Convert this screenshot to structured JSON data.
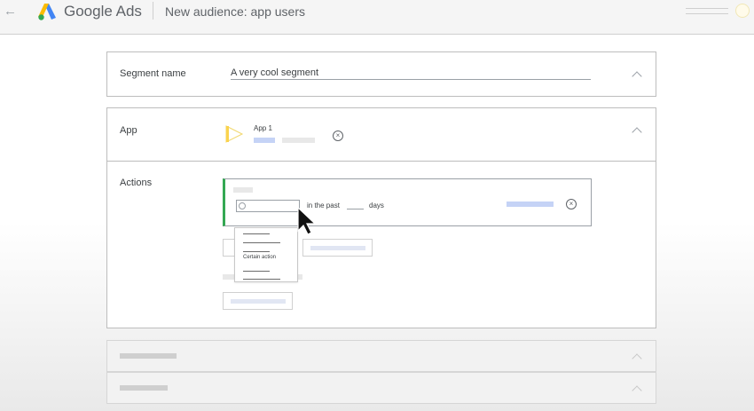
{
  "header": {
    "brand": "Google Ads",
    "title": "New audience: app users"
  },
  "segment": {
    "label": "Segment name",
    "value": "A very cool segment"
  },
  "app": {
    "label": "App",
    "app_name": "App 1"
  },
  "actions": {
    "label": "Actions",
    "in_the_past": "in the past",
    "days": "days",
    "dropdown_item": "Certain action"
  },
  "colors": {
    "accent_green": "#34a853",
    "placeholder_blue": "#c5d3f6"
  },
  "icons": [
    "back-arrow-icon",
    "google-ads-logo-icon",
    "chevron-up-icon",
    "app-play-icon",
    "remove-circle-icon",
    "search-icon",
    "mouse-cursor-icon"
  ]
}
